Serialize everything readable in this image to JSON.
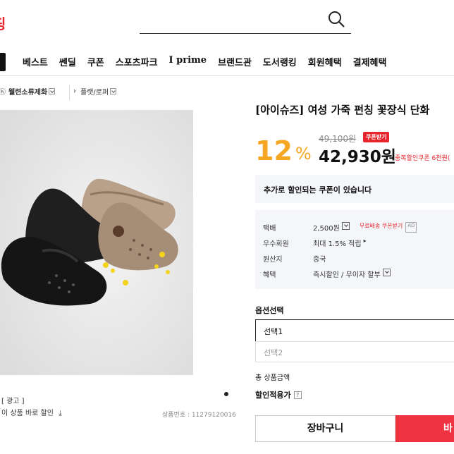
{
  "header": {
    "brand_fragment": "핑",
    "search_placeholder": ""
  },
  "gnb": {
    "items": [
      "베스트",
      "쎈딜",
      "쿠폰",
      "스포츠파크",
      "I prime",
      "브랜드관",
      "도서랭킹",
      "회원혜택",
      "결제혜택"
    ]
  },
  "breadcrumb": {
    "part1": "ⓗ",
    "part1b": "웰련소류제화",
    "part2": "플랫/로퍼"
  },
  "gallery": {
    "ad_label": "[ 광고 ]",
    "coupon_text": "이 상품 바로 할인",
    "product_number": "상품번호 : 11279120016"
  },
  "product": {
    "title": "[아이슈즈] 여성 가죽 펀칭 꽃장식 단화",
    "original_price": "49,100원",
    "coupon_badge": "쿠폰받기",
    "discount_value": "12",
    "discount_unit": "%",
    "final_price": "42,930원",
    "duplicate_coupon": "중복할인쿠폰 6천원(",
    "extra_coupon": "추가로 할인되는 쿠폰이 있습니다"
  },
  "info": {
    "shipping_label": "택배",
    "shipping_value": "2,500원",
    "free_shipping": "무료배송 쿠폰받기",
    "ad_tag": "AD",
    "member_label": "우수회원",
    "member_value": "최대 1.5% 적립",
    "origin_label": "원산지",
    "origin_value": "중국",
    "benefit_label": "혜택",
    "benefit_value": "즉시할인 / 무이자 할부"
  },
  "options": {
    "title": "옵션선택",
    "select1": "선택1",
    "select2": "선택2",
    "total_label": "총 상품금액",
    "discount_applied_label": "할인적용가",
    "help_icon": "?"
  },
  "actions": {
    "cart_label": "장바구니",
    "buy_label": "바"
  },
  "colors": {
    "accent_red": "#e8242c",
    "discount_orange": "#f5a623",
    "buy_button": "#ef3340"
  }
}
